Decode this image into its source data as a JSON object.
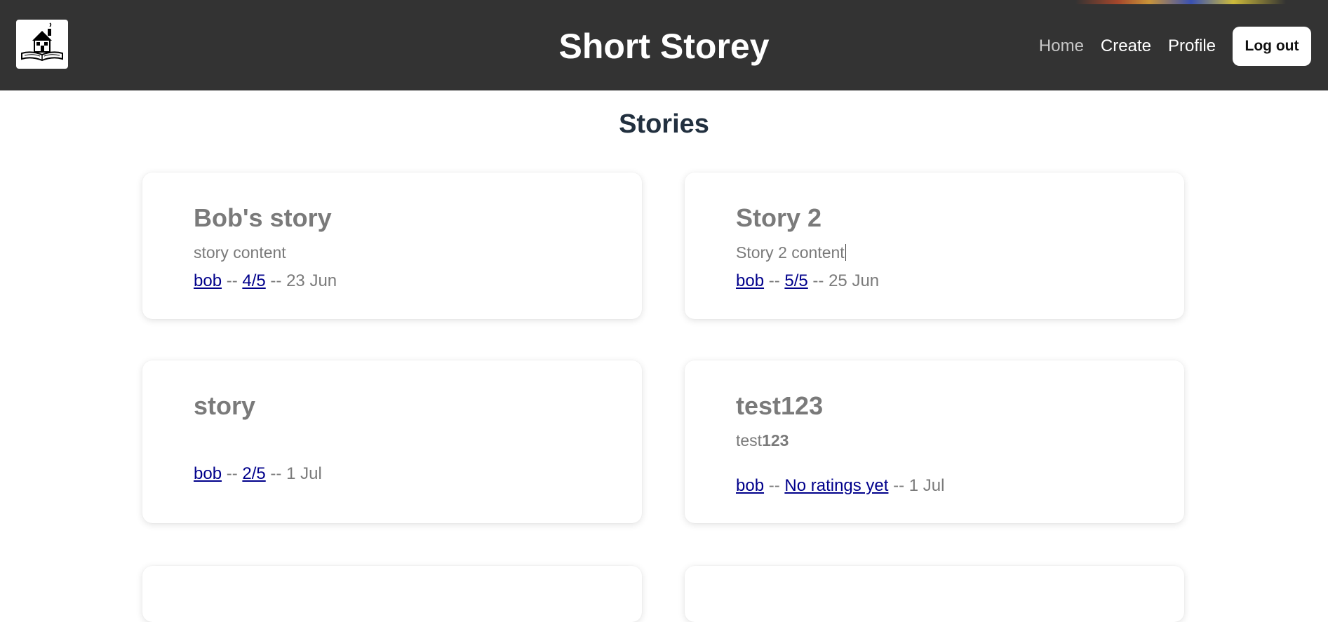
{
  "header": {
    "site_title": "Short Storey",
    "nav": {
      "home": "Home",
      "create": "Create",
      "profile": "Profile",
      "logout": "Log out"
    }
  },
  "page": {
    "heading": "Stories"
  },
  "stories": [
    {
      "title": "Bob's story",
      "content": "story content",
      "author": "bob",
      "rating": "4/5",
      "date": "23 Jun"
    },
    {
      "title": "Story 2",
      "content": "Story 2 content",
      "author": "bob",
      "rating": "5/5",
      "date": "25 Jun"
    },
    {
      "title": "story",
      "content": "",
      "author": "bob",
      "rating": "2/5",
      "date": "1 Jul"
    },
    {
      "title": "test123",
      "content_plain": "test",
      "content_bold": "123",
      "author": "bob",
      "rating": "No ratings yet",
      "date": "1 Jul"
    }
  ],
  "separator": " -- ",
  "colors": {
    "header_bg": "#333333",
    "link": "#00008b",
    "muted_text": "#7a7a7a",
    "heading": "#22303f"
  },
  "icons": {
    "logo": "house-on-open-book-logo"
  }
}
